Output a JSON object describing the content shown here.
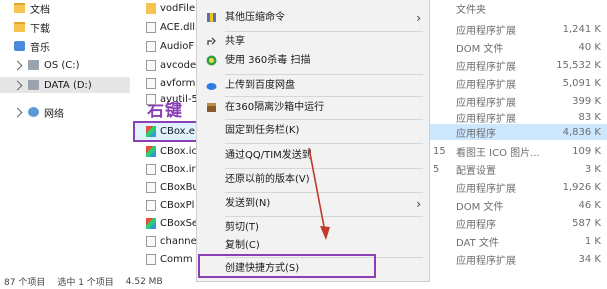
{
  "nav": {
    "items": [
      {
        "label": "文档",
        "icon": "documents-icon"
      },
      {
        "label": "下载",
        "icon": "downloads-icon"
      },
      {
        "label": "音乐",
        "icon": "music-icon"
      },
      {
        "label": "OS (C:)",
        "icon": "drive-icon"
      },
      {
        "label": "DATA (D:)",
        "icon": "drive-icon"
      },
      {
        "label": "网络",
        "icon": "network-icon"
      }
    ]
  },
  "files": [
    "vodFile",
    "ACE.dll",
    "AudioF",
    "avcode",
    "avform",
    "avutil-5",
    "CBox.e",
    "CBox.ic",
    "CBox.ir",
    "CBoxBu",
    "CBoxPl",
    "CBoxSe",
    "channe",
    "Comm"
  ],
  "right_click_label": "右键",
  "details": [
    {
      "col": "",
      "type": "文件夹",
      "size": ""
    },
    {
      "col": "",
      "type": "应用程序扩展",
      "size": "1,241 K"
    },
    {
      "col": "",
      "type": "DOM 文件",
      "size": "40 K"
    },
    {
      "col": "",
      "type": "应用程序扩展",
      "size": "15,532 K"
    },
    {
      "col": "",
      "type": "应用程序扩展",
      "size": "5,091 K"
    },
    {
      "col": "",
      "type": "应用程序扩展",
      "size": "399 K"
    },
    {
      "col": "",
      "type": "应用程序扩展",
      "size": "83 K"
    },
    {
      "col": "",
      "type": "应用程序",
      "size": "4,836 K"
    },
    {
      "col": "15",
      "type": "看图王 ICO 图片...",
      "size": "109 K"
    },
    {
      "col": "5",
      "type": "配置设置",
      "size": "3 K"
    },
    {
      "col": "",
      "type": "应用程序扩展",
      "size": "1,926 K"
    },
    {
      "col": "",
      "type": "DOM 文件",
      "size": "46 K"
    },
    {
      "col": "",
      "type": "应用程序",
      "size": "587 K"
    },
    {
      "col": "",
      "type": "DAT 文件",
      "size": "1 K"
    },
    {
      "col": "",
      "type": "应用程序扩展",
      "size": "34 K"
    }
  ],
  "menu": {
    "items": [
      {
        "label": "其他压缩命令",
        "icon": "archive-icon",
        "submenu": true
      },
      {
        "label": "共享",
        "icon": "share-icon",
        "submenu": false
      },
      {
        "label": "使用 360杀毒 扫描",
        "icon": "antivirus-icon",
        "submenu": false
      },
      {
        "label": "上传到百度网盘",
        "icon": "cloud-upload-icon",
        "submenu": false
      },
      {
        "label": "在360隔离沙箱中运行",
        "icon": "sandbox-icon",
        "submenu": false
      },
      {
        "label": "固定到任务栏(K)",
        "icon": "",
        "submenu": false
      },
      {
        "label": "通过QQ/TIM发送到",
        "icon": "",
        "submenu": false
      },
      {
        "label": "还原以前的版本(V)",
        "icon": "",
        "submenu": false
      },
      {
        "label": "发送到(N)",
        "icon": "",
        "submenu": true
      },
      {
        "label": "剪切(T)",
        "icon": "",
        "submenu": false
      },
      {
        "label": "复制(C)",
        "icon": "",
        "submenu": false
      },
      {
        "label": "创建快捷方式(S)",
        "icon": "",
        "submenu": false
      }
    ]
  },
  "status": {
    "count": "87 个项目",
    "selected": "选中 1 个项目",
    "size": "4.52 MB"
  },
  "colors": {
    "highlight": "#8a3fb5",
    "selection": "#cce8ff",
    "arrow": "#c0392b"
  }
}
